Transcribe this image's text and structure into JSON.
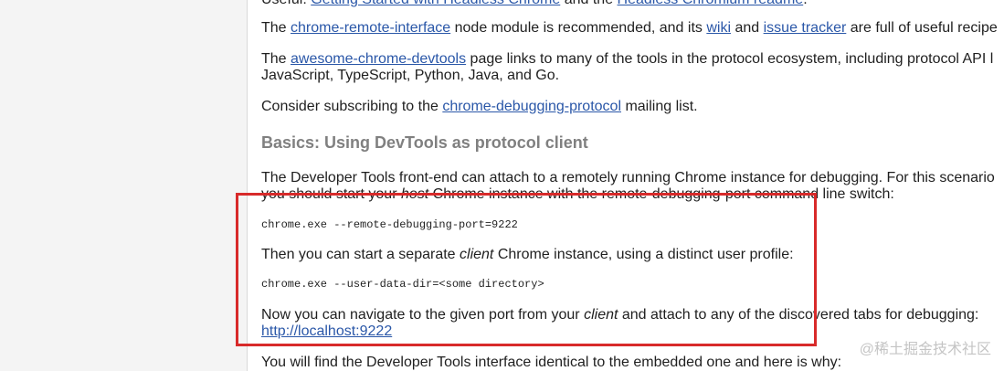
{
  "paragraphs": {
    "top_cut": {
      "prefix": "Useful: ",
      "link1": "Getting Started with Headless Chrome",
      "mid": " and the ",
      "link2": "Headless Chromium readme",
      "suffix": "."
    },
    "p1": {
      "before": "The ",
      "link1": "chrome-remote-interface",
      "mid1": " node module is recommended, and its ",
      "link2": "wiki",
      "mid2": " and ",
      "link3": "issue tracker",
      "after": " are full of useful recipe"
    },
    "p2": {
      "before": "The ",
      "link": "awesome-chrome-devtools",
      "after": " page links to many of the tools in the protocol ecosystem, including protocol API l",
      "line2": "JavaScript, TypeScript, Python, Java, and Go."
    },
    "p3": {
      "before": "Consider subscribing to the ",
      "link": "chrome-debugging-protocol",
      "after": " mailing list."
    },
    "heading": "Basics: Using DevTools as protocol client",
    "p4": {
      "line1": "The Developer Tools front-end can attach to a remotely running Chrome instance for debugging. For this scenario",
      "line2_before": "you should start your ",
      "line2_em": "host",
      "line2_after": " Chrome instance with the remote-debugging-port command line switch:"
    },
    "code1": "chrome.exe --remote-debugging-port=9222",
    "p5": {
      "before": "Then you can start a separate ",
      "em": "client",
      "after": " Chrome instance, using a distinct user profile:"
    },
    "code2": "chrome.exe --user-data-dir=<some directory>",
    "p6": {
      "before": "Now you can navigate to the given port from your ",
      "em": "client",
      "after": " and attach to any of the discovered tabs for debugging:",
      "link": "http://localhost:9222"
    },
    "p7": "You will find the Developer Tools interface identical to the embedded one and here is why:"
  },
  "watermark": "@稀土掘金技术社区",
  "colors": {
    "link": "#2a57a8",
    "heading": "#808080",
    "highlight": "#d82a2a"
  }
}
